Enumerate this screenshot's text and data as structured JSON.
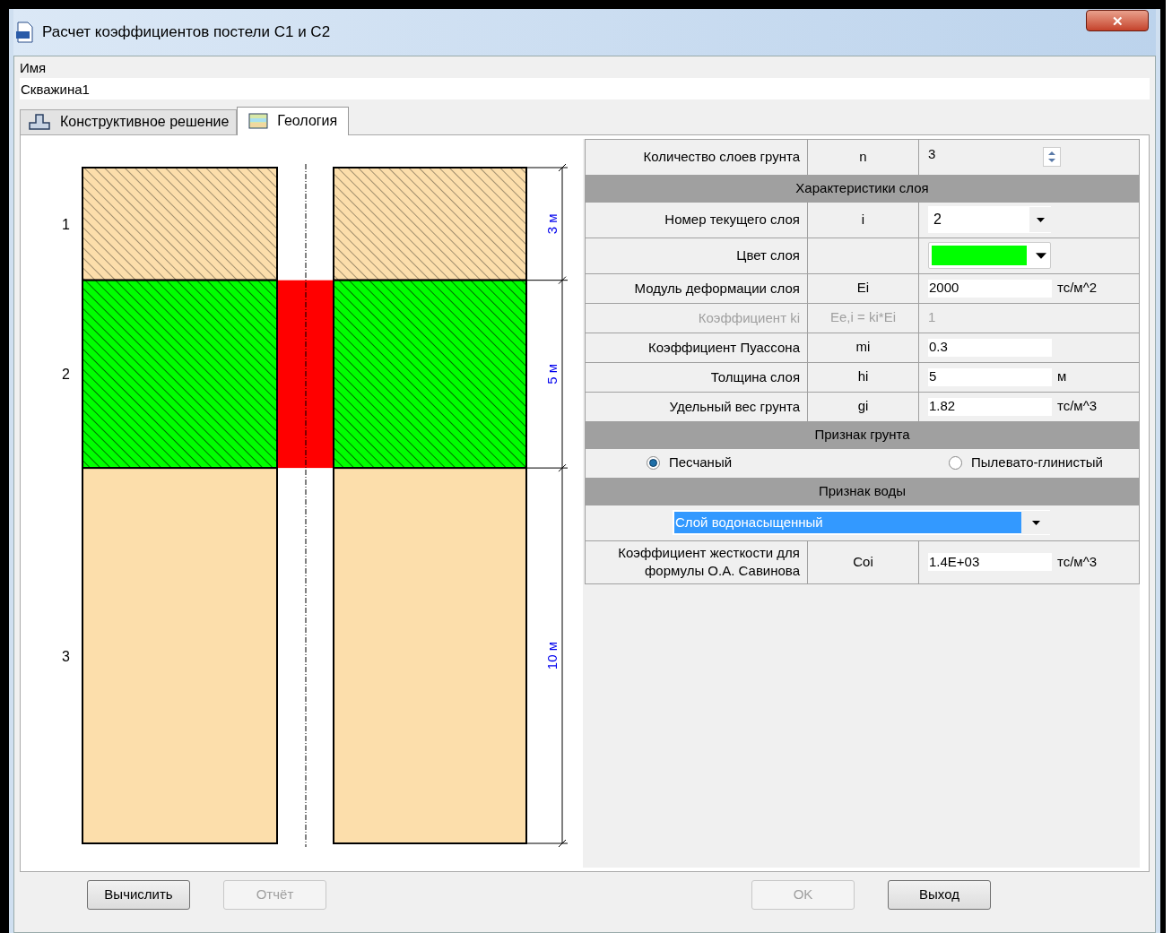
{
  "window": {
    "title": "Расчет коэффициентов постели С1 и С2",
    "close": "✕"
  },
  "name_field": {
    "label": "Имя",
    "value": "Скважина1"
  },
  "tabs": [
    {
      "label": "Конструктивное решение",
      "selected": false
    },
    {
      "label": "Геология",
      "selected": true
    }
  ],
  "section": {
    "layers": [
      {
        "number": "1",
        "thickness": "3 м",
        "color": "#fcdeab",
        "hatched": true,
        "selected": false
      },
      {
        "number": "2",
        "thickness": "5 м",
        "color": "#00ff00",
        "hatched": true,
        "selected": true
      },
      {
        "number": "3",
        "thickness": "10 м",
        "color": "#fcdeab",
        "hatched": false,
        "selected": false
      }
    ]
  },
  "properties": [
    {
      "kind": "spinner",
      "label": "Количество слоев грунта",
      "symbol": "n",
      "value": "3",
      "disabled": false
    },
    {
      "kind": "header",
      "label": "Характеристики слоя"
    },
    {
      "kind": "dropdown",
      "label": "Номер текущего слоя",
      "symbol": "i",
      "value": "2",
      "disabled": false
    },
    {
      "kind": "color",
      "label": "Цвет слоя",
      "color": "#00ff00",
      "disabled": false
    },
    {
      "kind": "input",
      "label": "Модуль деформации слоя",
      "symbol": "Ei",
      "value": "2000",
      "unit": "тс/м^2",
      "disabled": false
    },
    {
      "kind": "text",
      "label": "Коэффициент ki",
      "symbol": "Ee,i = ki*Ei",
      "value": "1",
      "disabled": true
    },
    {
      "kind": "input",
      "label": "Коэффициент Пуассона",
      "symbol": "mi",
      "value": "0.3",
      "disabled": false
    },
    {
      "kind": "input",
      "label": "Толщина слоя",
      "symbol": "hi",
      "value": "5",
      "unit": "м",
      "disabled": false
    },
    {
      "kind": "input",
      "label": "Удельный вес грунта",
      "symbol": "gi",
      "value": "1.82",
      "unit": "тс/м^3",
      "disabled": false
    },
    {
      "kind": "header",
      "label": "Признак грунта"
    },
    {
      "kind": "radio",
      "options": [
        {
          "label": "Песчаный",
          "selected": true
        },
        {
          "label": "Пылевато-глинистый",
          "selected": false
        }
      ]
    },
    {
      "kind": "header",
      "label": "Признак воды"
    },
    {
      "kind": "select",
      "value": "Слой водонасыщенный",
      "highlighted": true
    },
    {
      "kind": "input",
      "label": "Коэффициент жесткости для формулы О.А. Савинова",
      "symbol": "Coi",
      "value": "1.4E+03",
      "unit": "тс/м^3",
      "disabled": false
    }
  ],
  "buttons": [
    {
      "label": "Вычислить",
      "disabled": false
    },
    {
      "label": "Отчёт",
      "disabled": true
    },
    {
      "label": "OK",
      "disabled": true
    },
    {
      "label": "Выход",
      "disabled": false
    }
  ]
}
